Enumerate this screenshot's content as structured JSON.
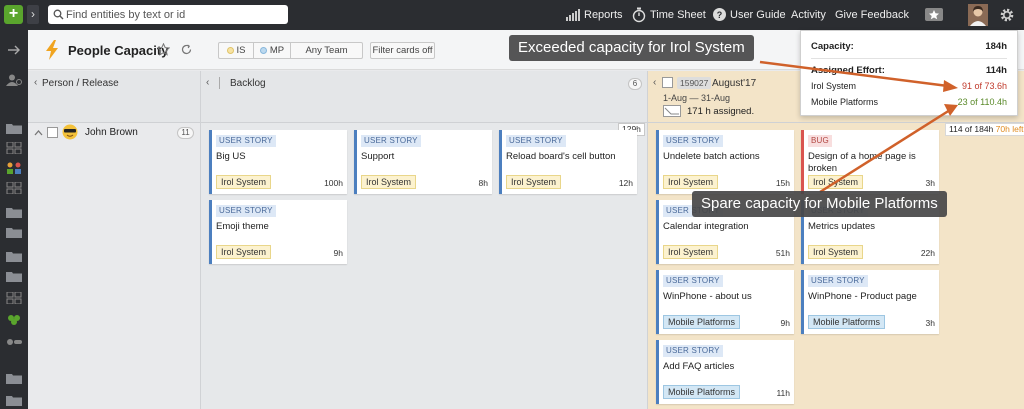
{
  "topbar": {
    "search_placeholder": "Find entities by text or id",
    "nav": [
      "Reports",
      "Time Sheet",
      "User Guide",
      "Activity",
      "Give Feedback"
    ]
  },
  "header": {
    "title": "People Capacity",
    "filters": {
      "is": "IS",
      "mp": "MP",
      "team": "Any Team",
      "filter_cards": "Filter cards off"
    }
  },
  "columns": {
    "person": "Person / Release",
    "backlog": "Backlog",
    "backlog_count": "6",
    "release_id": "159027",
    "release_name": "August'17",
    "release_dates": "1-Aug — 31-Aug",
    "assigned_hours": "171 h",
    "assigned_label": "assigned."
  },
  "person": {
    "name": "John Brown",
    "count": "11",
    "backlog_total": "129h"
  },
  "capacity_bar": {
    "used": "114 of 184h",
    "left": "70h left"
  },
  "tooltip": {
    "capacity_label": "Capacity:",
    "capacity_value": "184h",
    "effort_label": "Assigned Effort:",
    "effort_value": "114h",
    "rows": [
      {
        "team": "Irol System",
        "value": "91 of 73.6h",
        "color": "#c0392b"
      },
      {
        "team": "Mobile Platforms",
        "value": "23 of 110.4h",
        "color": "#5a8a2a"
      }
    ]
  },
  "cards": [
    {
      "type": "USER STORY",
      "title": "Big US",
      "team": "Irol System",
      "est": "100h"
    },
    {
      "type": "USER STORY",
      "title": "Support",
      "team": "Irol System",
      "est": "8h"
    },
    {
      "type": "USER STORY",
      "title": "Reload board's cell button",
      "team": "Irol System",
      "est": "12h"
    },
    {
      "type": "USER STORY",
      "title": "Emoji theme",
      "team": "Irol System",
      "est": "9h"
    },
    {
      "type": "USER STORY",
      "title": "Undelete batch actions",
      "team": "Irol System",
      "est": "15h"
    },
    {
      "type": "BUG",
      "title": "Design of a home page is broken",
      "team": "Irol System",
      "est": "3h"
    },
    {
      "type": "USER STORY",
      "title": "Calendar integration",
      "team": "Irol System",
      "est": "51h"
    },
    {
      "type": "USER STORY",
      "title": "Metrics updates",
      "team": "Irol System",
      "est": "22h"
    },
    {
      "type": "USER STORY",
      "title": "WinPhone - about us",
      "team": "Mobile Platforms",
      "est": "9h"
    },
    {
      "type": "USER STORY",
      "title": "WinPhone - Product page",
      "team": "Mobile Platforms",
      "est": "3h"
    },
    {
      "type": "USER STORY",
      "title": "Add FAQ articles",
      "team": "Mobile Platforms",
      "est": "11h"
    }
  ],
  "annotations": {
    "exceeded": "Exceeded capacity for Irol System",
    "spare": "Spare capacity for Mobile Platforms"
  },
  "colors": {
    "accent_green": "#5aa52d",
    "bug": "#d9544f",
    "story": "#4c7fbf",
    "over": "#c0392b",
    "spare": "#5a8a2a"
  }
}
